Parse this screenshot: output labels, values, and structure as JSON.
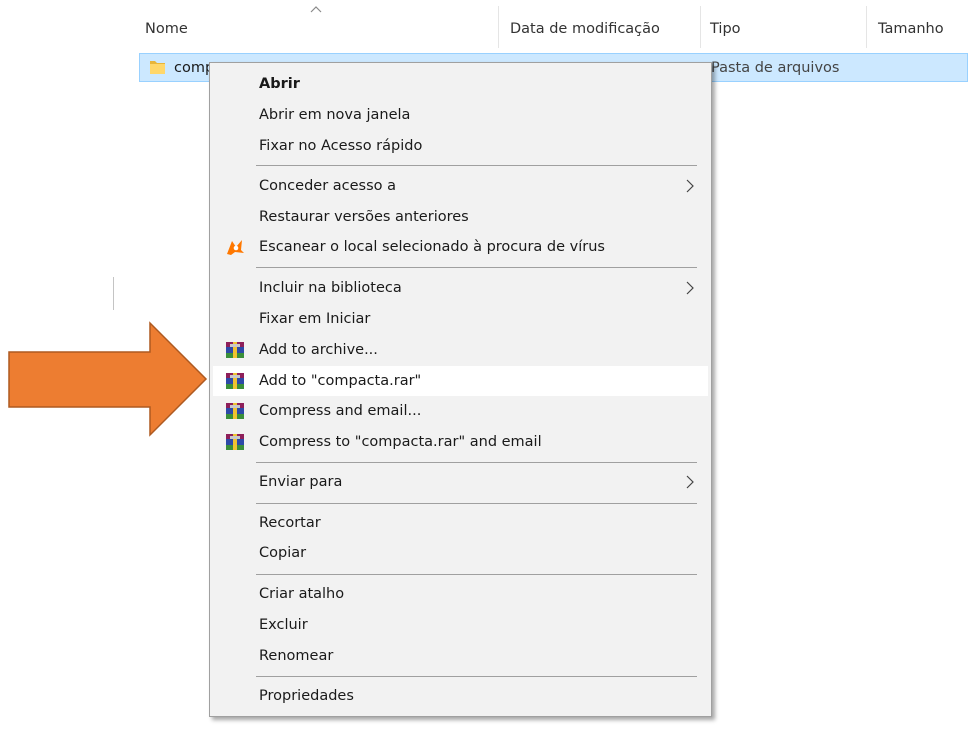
{
  "columns": {
    "name": "Nome",
    "date": "Data de modificação",
    "type": "Tipo",
    "size": "Tamanho"
  },
  "file": {
    "name": "comp",
    "type": "Pasta de arquivos"
  },
  "menu": {
    "open": "Abrir",
    "open_new_window": "Abrir em nova janela",
    "pin_quick_access": "Fixar no Acesso rápido",
    "give_access": "Conceder acesso a",
    "restore_versions": "Restaurar versões anteriores",
    "scan_virus": "Escanear o local selecionado à procura de vírus",
    "include_library": "Incluir na biblioteca",
    "pin_start": "Fixar em Iniciar",
    "add_archive": "Add to archive...",
    "add_rar": "Add to \"compacta.rar\"",
    "compress_email": "Compress and email...",
    "compress_rar_email": "Compress to \"compacta.rar\" and email",
    "send_to": "Enviar para",
    "cut": "Recortar",
    "copy": "Copiar",
    "create_shortcut": "Criar atalho",
    "delete": "Excluir",
    "rename": "Renomear",
    "properties": "Propriedades"
  },
  "icons": {
    "folder": "folder-icon",
    "avast": "avast-icon",
    "winrar": "winrar-icon",
    "submenu": "chevron-right-icon",
    "sort": "sort-ascending-icon",
    "annotation": "orange-arrow-icon"
  },
  "colors": {
    "selection_bg": "#cce8ff",
    "selection_border": "#99d1ff",
    "menu_bg": "#f2f2f2",
    "menu_hover": "#ffffff",
    "avast_orange": "#ff7800",
    "annotation_orange": "#ed7d31"
  }
}
